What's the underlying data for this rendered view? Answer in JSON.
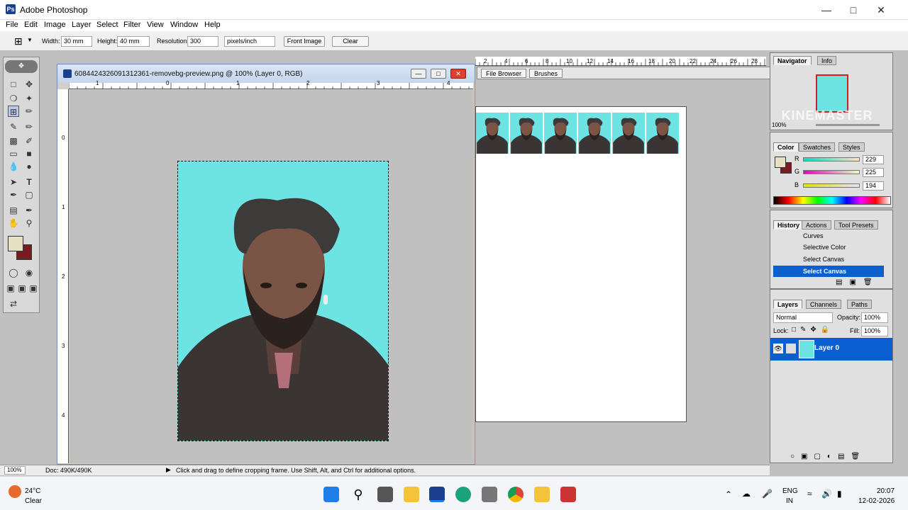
{
  "app": {
    "title": "Adobe Photoshop"
  },
  "menu": [
    "File",
    "Edit",
    "Image",
    "Layer",
    "Select",
    "Filter",
    "View",
    "Window",
    "Help"
  ],
  "options": {
    "width_label": "Width:",
    "width_value": "30 mm",
    "height_label": "Height:",
    "height_value": "40 mm",
    "resolution_label": "Resolution:",
    "resolution_value": "300",
    "unit": "pixels/inch",
    "front_image": "Front Image",
    "clear": "Clear",
    "palette_tabs": [
      "File Browser",
      "Brushes"
    ]
  },
  "document": {
    "title": "6084424326091312361-removebg-preview.png @ 100% (Layer 0, RGB)",
    "hruler": [
      "1",
      "0",
      "1",
      "2",
      "3",
      "4"
    ],
    "vruler": [
      "0",
      "1",
      "2",
      "3",
      "4"
    ],
    "doc2_ruler": [
      "2",
      "4",
      "6",
      "8",
      "10",
      "12",
      "14",
      "16",
      "18",
      "20",
      "22",
      "24",
      "26",
      "28"
    ],
    "background_color": "#6de3e4"
  },
  "status": {
    "zoom": "100%",
    "doc": "Doc: 490K/490K",
    "hint": "Click and drag to define cropping frame. Use Shift, Alt, and Ctrl for additional options."
  },
  "navigator": {
    "tabs": [
      "Navigator",
      "Info"
    ],
    "zoom": "100%"
  },
  "watermark": "KINEMASTER",
  "color": {
    "tabs": [
      "Color",
      "Swatches",
      "Styles"
    ],
    "r_label": "R",
    "r": "229",
    "g_label": "G",
    "g": "225",
    "b_label": "B",
    "b": "194",
    "foreground": "#e5e1c2",
    "background": "#7a1a22"
  },
  "history": {
    "tabs": [
      "History",
      "Actions",
      "Tool Presets"
    ],
    "items": [
      "Curves",
      "Selective Color",
      "Select Canvas",
      "Select Canvas"
    ]
  },
  "layers": {
    "tabs": [
      "Layers",
      "Channels",
      "Paths"
    ],
    "blend": "Normal",
    "opacity_label": "Opacity:",
    "opacity": "100%",
    "lock_label": "Lock:",
    "fill_label": "Fill:",
    "fill": "100%",
    "layer_name": "Layer 0"
  },
  "taskbar": {
    "temp": "24°C",
    "weather": "Clear",
    "lang_top": "ENG",
    "lang_bottom": "IN",
    "time": "20:07",
    "date": "12-02-2026"
  }
}
